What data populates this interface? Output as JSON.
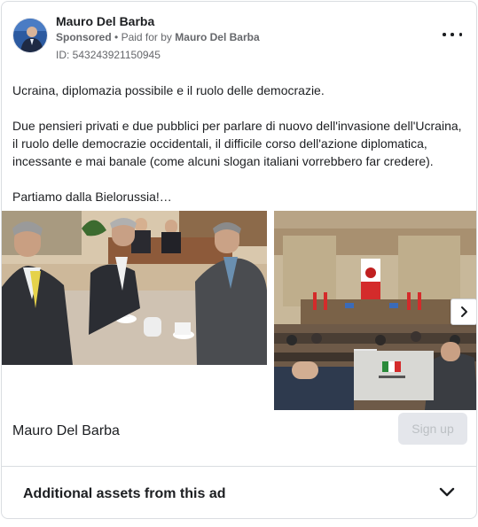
{
  "ad": {
    "page_name": "Mauro Del Barba",
    "sponsored_label": "Sponsored",
    "bullet": "•",
    "paid_for_prefix": "Paid for by",
    "paid_for_name": "Mauro Del Barba",
    "id_label": "ID: 543243921150945",
    "more_icon": "more-horizontal-icon"
  },
  "body": {
    "paragraphs": [
      "Ucraina, diplomazia possibile e il ruolo delle democrazie.",
      "Due pensieri privati e due pubblici per parlare di nuovo dell'invasione dell'Ucraina, il ruolo delle democrazie occidentali, il difficile corso dell'azione diplomatica, incessante e mai banale (come alcuni slogan italiani vorrebbero far credere).",
      "Partiamo dalla Bielorussia!…"
    ]
  },
  "carousel": {
    "next_icon": "chevron-right-icon"
  },
  "caption": {
    "title": "Mauro Del Barba",
    "cta_label": "Sign up"
  },
  "assets": {
    "label": "Additional assets from this ad",
    "chevron_icon": "chevron-down-icon"
  }
}
